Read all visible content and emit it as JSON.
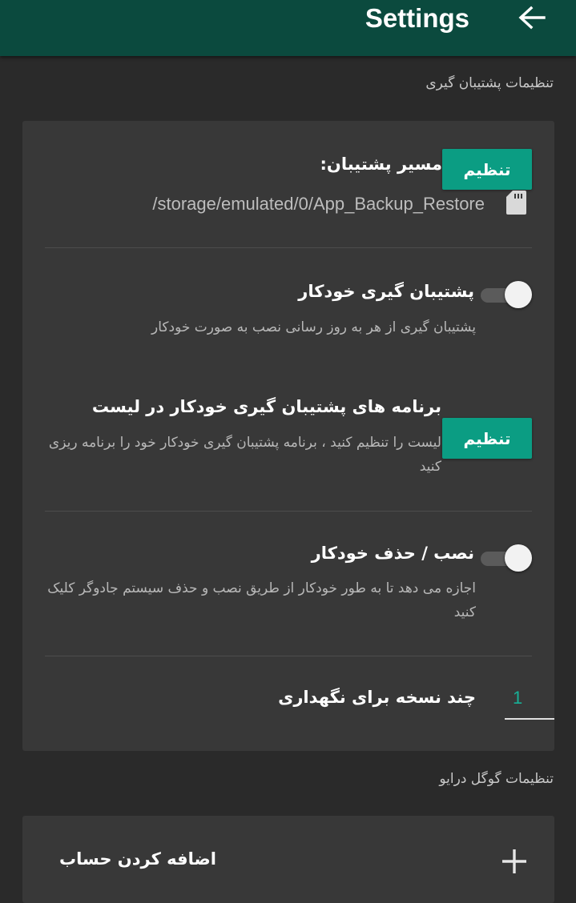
{
  "appbar": {
    "title": "Settings",
    "back_icon": "arrow-left-icon"
  },
  "backup_section": {
    "title": "تنظیمات پشتیبان گیری",
    "backup_path": {
      "title": "مسیر پشتیبان:",
      "button_label": "تنظیم",
      "path": "/storage/emulated/0/App_Backup_Restore",
      "icon": "sd-card-icon"
    },
    "auto_backup": {
      "title": "پشتیبان گیری خودکار",
      "description": "پشتیبان گیری از هر به روز رسانی نصب به صورت خودکار",
      "enabled": false
    },
    "auto_backup_list": {
      "title": "برنامه های پشتیبان گیری خودکار در لیست",
      "description": "لیست را تنظیم کنید ، برنامه پشتیبان گیری خودکار خود را برنامه ریزی کنید",
      "button_label": "تنظیم"
    },
    "auto_install": {
      "title": "نصب / حذف خودکار",
      "description": "اجازه می دهد تا به طور خودکار از طریق نصب و حذف سیستم جادوگر کلیک کنید",
      "enabled": false
    },
    "versions": {
      "title": "چند نسخه برای نگهداری",
      "value": "1"
    }
  },
  "drive_section": {
    "title": "تنظیمات گوگل درایو",
    "add_account": {
      "label": "اضافه کردن حساب",
      "icon": "plus-icon"
    }
  },
  "colors": {
    "appbar": "#0b4a3e",
    "accent": "#0b9d83",
    "background": "#2a2a2a",
    "card": "#383838"
  }
}
